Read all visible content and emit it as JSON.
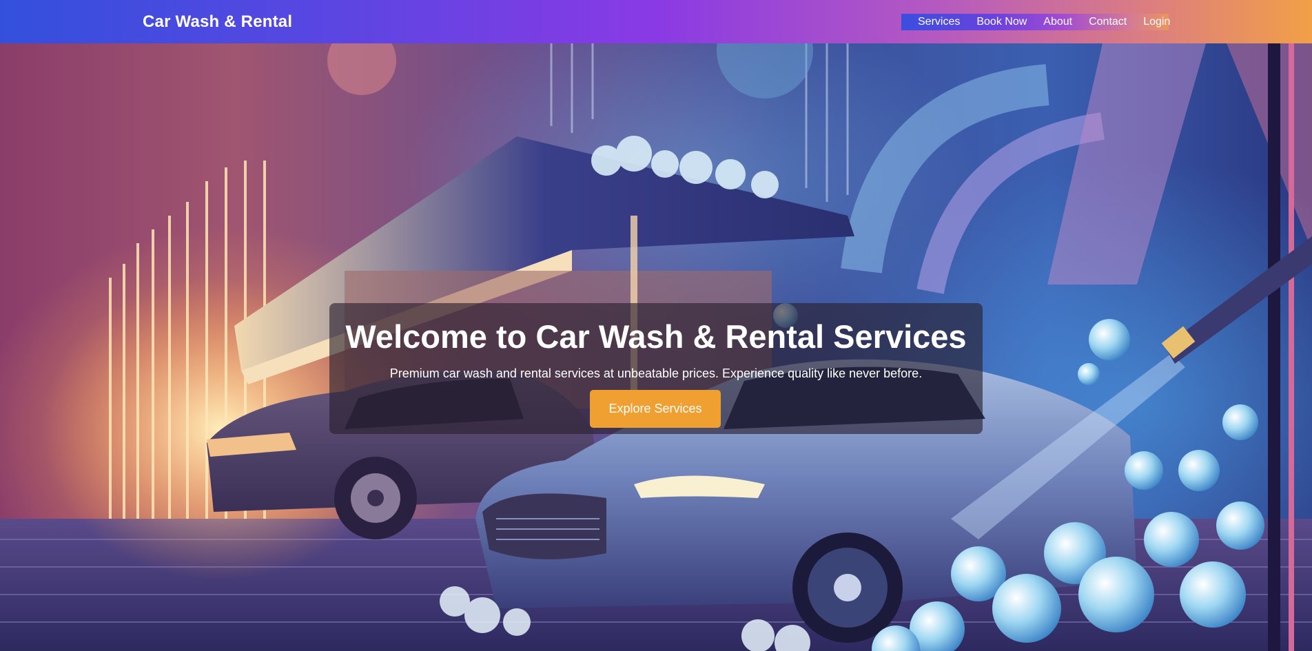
{
  "navbar": {
    "brand": "Car Wash & Rental",
    "links": [
      {
        "label": "Services"
      },
      {
        "label": "Book Now"
      },
      {
        "label": "About"
      },
      {
        "label": "Contact"
      },
      {
        "label": "Login"
      }
    ]
  },
  "hero": {
    "title": "Welcome to Car Wash & Rental Services",
    "subtitle": "Premium car wash and rental services at unbeatable prices. Experience quality like never before.",
    "cta_label": "Explore Services",
    "cta_color": "#f0a030"
  },
  "colors": {
    "navbar_gradient_start": "#3350dc",
    "navbar_gradient_mid": "#8a3ae4",
    "navbar_gradient_end": "#f1a047"
  },
  "icons": []
}
